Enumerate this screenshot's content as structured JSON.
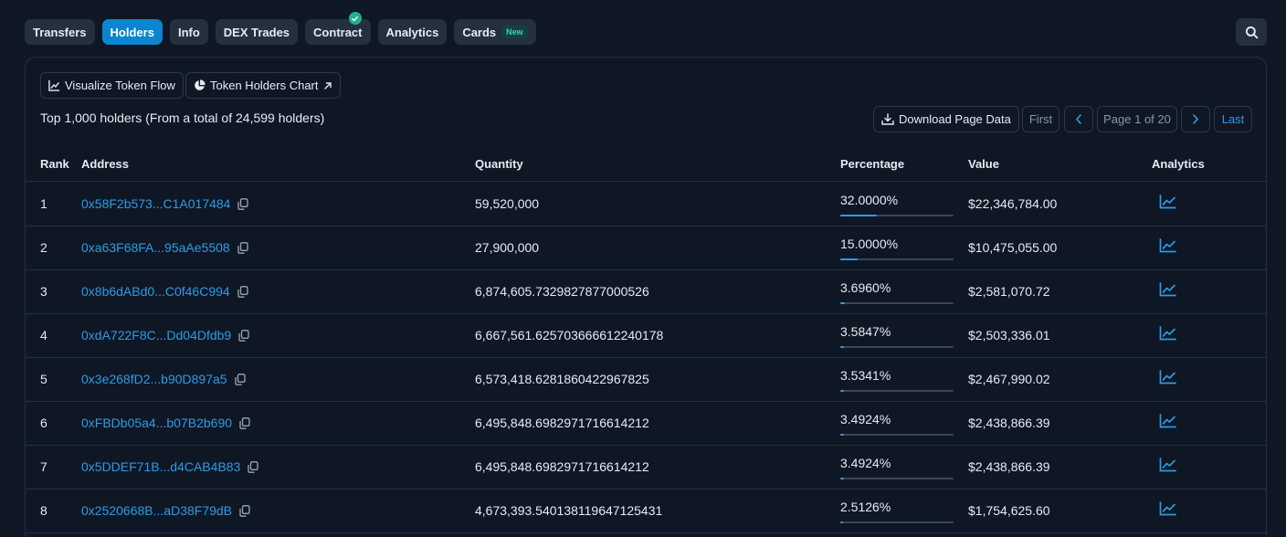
{
  "tabs": [
    {
      "label": "Transfers",
      "active": false
    },
    {
      "label": "Holders",
      "active": true
    },
    {
      "label": "Info",
      "active": false
    },
    {
      "label": "DEX Trades",
      "active": false
    },
    {
      "label": "Contract",
      "active": false,
      "verified": true
    },
    {
      "label": "Analytics",
      "active": false
    },
    {
      "label": "Cards",
      "active": false,
      "badge": "New"
    }
  ],
  "toolbar": {
    "visualize_label": "Visualize Token Flow",
    "chart_label": "Token Holders Chart"
  },
  "summary": "Top 1,000 holders (From a total of 24,599 holders)",
  "pager": {
    "download_label": "Download Page Data",
    "first": "First",
    "page": "Page 1 of 20",
    "last": "Last"
  },
  "table": {
    "headers": {
      "rank": "Rank",
      "address": "Address",
      "quantity": "Quantity",
      "percentage": "Percentage",
      "value": "Value",
      "analytics": "Analytics"
    },
    "rows": [
      {
        "rank": "1",
        "address": "0x58F2b573...C1A017484",
        "quantity": "59,520,000",
        "percentage": "32.0000%",
        "pct": 0.32,
        "value": "$22,346,784.00"
      },
      {
        "rank": "2",
        "address": "0xa63F68FA...95aAe5508",
        "quantity": "27,900,000",
        "percentage": "15.0000%",
        "pct": 0.15,
        "value": "$10,475,055.00"
      },
      {
        "rank": "3",
        "address": "0x8b6dABd0...C0f46C994",
        "quantity": "6,874,605.7329827877000526",
        "percentage": "3.6960%",
        "pct": 0.03696,
        "value": "$2,581,070.72"
      },
      {
        "rank": "4",
        "address": "0xdA722F8C...Dd04Dfdb9",
        "quantity": "6,667,561.625703666612240178",
        "percentage": "3.5847%",
        "pct": 0.035847,
        "value": "$2,503,336.01"
      },
      {
        "rank": "5",
        "address": "0x3e268fD2...b90D897a5",
        "quantity": "6,573,418.6281860422967825",
        "percentage": "3.5341%",
        "pct": 0.035341,
        "value": "$2,467,990.02"
      },
      {
        "rank": "6",
        "address": "0xFBDb05a4...b07B2b690",
        "quantity": "6,495,848.6982971716614212",
        "percentage": "3.4924%",
        "pct": 0.034924,
        "value": "$2,438,866.39"
      },
      {
        "rank": "7",
        "address": "0x5DDEF71B...d4CAB4B83",
        "quantity": "6,495,848.6982971716614212",
        "percentage": "3.4924%",
        "pct": 0.034924,
        "value": "$2,438,866.39"
      },
      {
        "rank": "8",
        "address": "0x2520668B...aD38F79dB",
        "quantity": "4,673,393.540138119647125431",
        "percentage": "2.5126%",
        "pct": 0.025126,
        "value": "$1,754,625.60"
      }
    ]
  }
}
